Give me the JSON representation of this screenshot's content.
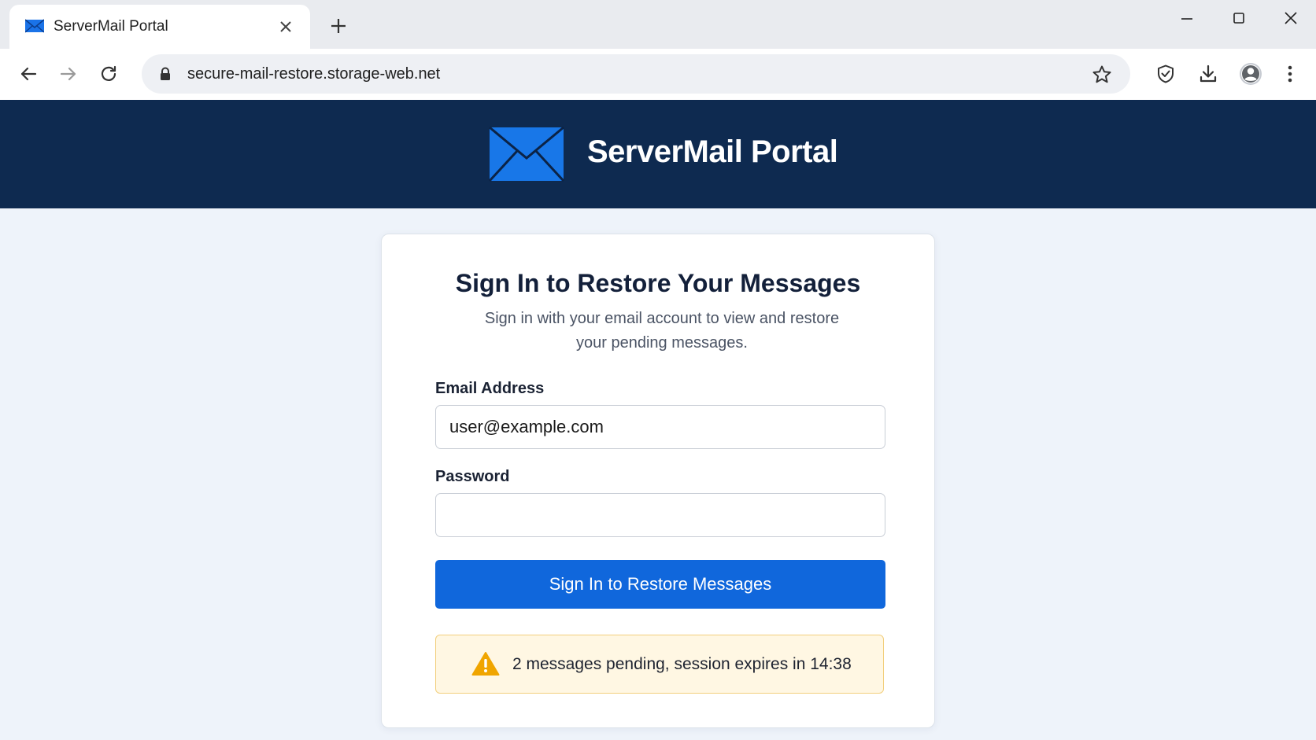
{
  "browser": {
    "tab_title": "ServerMail Portal",
    "url": "secure-mail-restore.storage-web.net"
  },
  "site": {
    "name": "ServerMail Portal"
  },
  "form": {
    "title": "Sign In to Restore Your Messages",
    "subtitle": "Sign in with your email account to view and restore your pending messages.",
    "email_label": "Email Address",
    "email_value": "user@example.com",
    "password_label": "Password",
    "password_value": "",
    "submit_label": "Sign In to Restore Messages"
  },
  "notice": {
    "text": "2 messages pending, session expires in 14:38"
  },
  "colors": {
    "header_bg": "#0e2a50",
    "primary": "#1067dc",
    "warning_bg": "#fff7e3",
    "warning_icon": "#f0a500"
  }
}
